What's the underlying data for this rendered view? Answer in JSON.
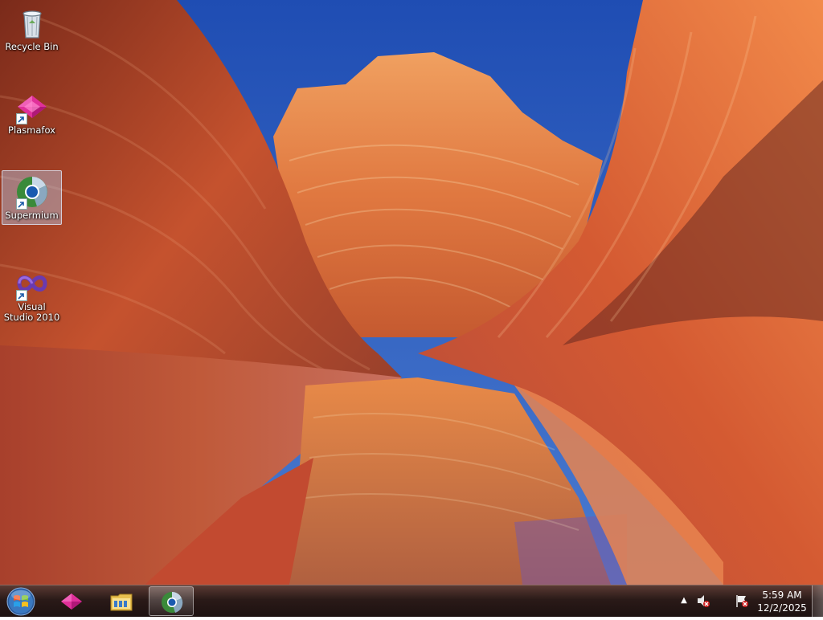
{
  "desktop": {
    "icons": [
      {
        "label": "Recycle Bin",
        "icon": "recycle-bin-icon",
        "selected": false
      },
      {
        "label": "Plasmafox",
        "icon": "plasmafox-icon",
        "selected": false
      },
      {
        "label": "Supermium",
        "icon": "supermium-icon",
        "selected": true
      },
      {
        "label": "Visual Studio 2010",
        "icon": "visual-studio-icon",
        "selected": false
      }
    ]
  },
  "taskbar": {
    "start": {
      "icon": "windows-start-orb-icon"
    },
    "pinned": [
      {
        "icon": "plasmafox-icon",
        "active": false
      },
      {
        "icon": "file-explorer-icon",
        "active": false
      },
      {
        "icon": "supermium-icon",
        "active": true
      }
    ],
    "tray": {
      "overflow_icon": "chevron-up-icon",
      "icons": [
        "volume-muted-icon",
        "action-center-flag-icon"
      ],
      "time": "5:59 AM",
      "date": "12/2/2025"
    }
  },
  "colors": {
    "sky": "#2e5fbf",
    "rock_orange": "#e8713a",
    "rock_red": "#b5422c",
    "taskbar": "#2a1a18"
  }
}
